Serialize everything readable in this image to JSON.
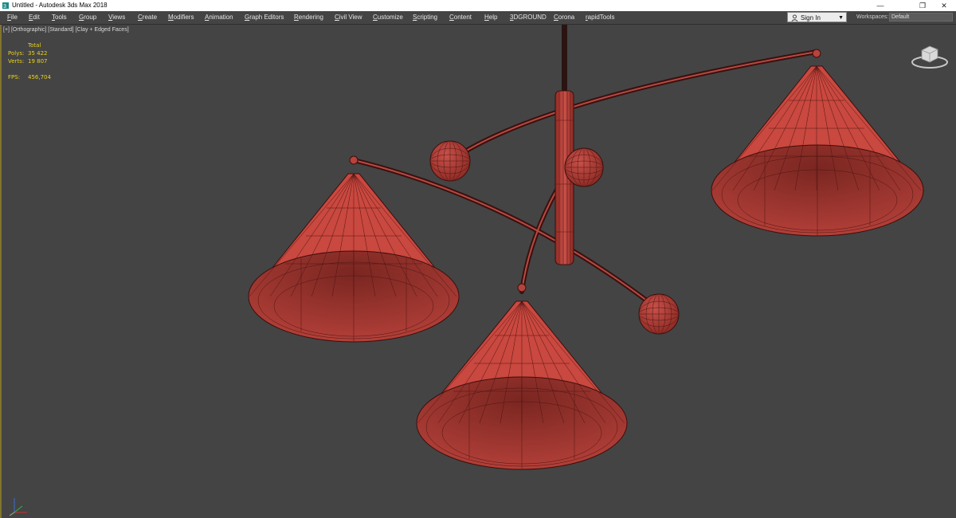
{
  "window": {
    "title": "Untitled - Autodesk 3ds Max 2018",
    "controls": {
      "minimize": "—",
      "restore": "❐",
      "close": "✕"
    }
  },
  "menu": [
    "File",
    "Edit",
    "Tools",
    "Group",
    "Views",
    "Create",
    "Modifiers",
    "Animation",
    "Graph Editors",
    "Rendering",
    "Civil View",
    "Customize",
    "Scripting",
    "Content",
    "Help",
    "3DGROUND",
    "Corona",
    "rapidTools"
  ],
  "account": {
    "signin_label": "Sign In"
  },
  "workspaces": {
    "label": "Workspaces:",
    "value": "Default"
  },
  "viewport": {
    "label_plus": "[+]",
    "label_view": "[Orthographic]",
    "label_shading": "[Standard]",
    "label_mode": "[Clay + Edged Faces]"
  },
  "stats": {
    "header": "Total",
    "polys_label": "Polys:",
    "polys_value": "35 422",
    "verts_label": "Verts:",
    "verts_value": "19 807",
    "fps_label": "FPS:",
    "fps_value": "456,704"
  },
  "colors": {
    "viewport_bg": "#444444",
    "clay_fill": "#c0453c",
    "clay_edge": "#3d0e0c",
    "stats_text": "#e8d220"
  },
  "icons": {
    "app": "3dsmax-app-icon",
    "user": "user-icon",
    "viewcube": "viewcube-icon",
    "axis": "axis-tripod-icon"
  }
}
